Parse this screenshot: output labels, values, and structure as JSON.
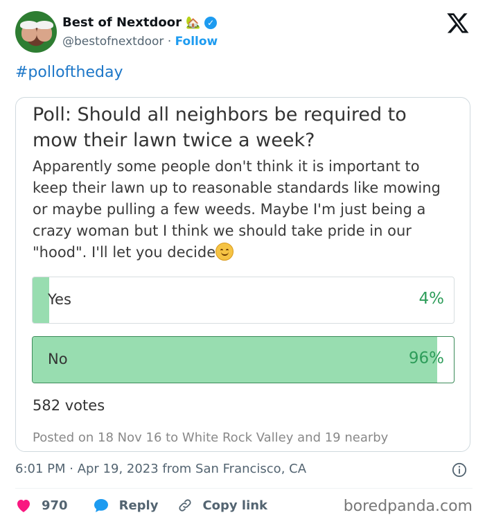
{
  "account": {
    "display_name": "Best of Nextdoor",
    "handle": "@bestofnextdoor",
    "separator": "·",
    "follow_label": "Follow",
    "badge_icon": "house-emoji-icon",
    "verified_color": "#1d9bf0"
  },
  "post": {
    "hashtag": "#polloftheday"
  },
  "poll": {
    "title": "Poll: Should all neighbors be required to mow their lawn twice a week?",
    "body": "Apparently some people don't think it is important to keep their lawn up to reasonable standards like mowing or maybe pulling a few weeds. Maybe I'm just being a crazy woman but I think we should take pride in our \"hood\". I'll let you decide",
    "options": [
      {
        "label": "Yes",
        "percent_text": "4%",
        "fraction": 0.04
      },
      {
        "label": "No",
        "percent_text": "96%",
        "fraction": 0.96
      }
    ],
    "votes": "582 votes",
    "posted": "Posted on 18 Nov 16 to White Rock Valley and 19 nearby",
    "fill_color": "#98ddb0",
    "percent_color": "#2e9d5a"
  },
  "meta": {
    "timestamp": "6:01 PM · Apr 19, 2023 from San Francisco, CA"
  },
  "actions": {
    "like_count": "970",
    "reply_label": "Reply",
    "copy_label": "Copy link",
    "like_color": "#f91880",
    "reply_color": "#1d9bf0"
  },
  "watermark": "boredpanda.com"
}
